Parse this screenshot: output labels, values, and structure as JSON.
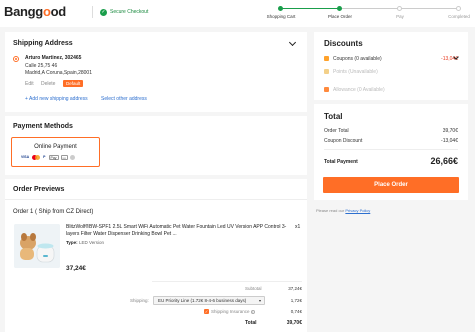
{
  "header": {
    "logo_left": "Bangg",
    "logo_o": "o",
    "logo_right": "od",
    "secure_label": "Secure Checkout",
    "secure_icon": "check-shield-icon",
    "steps": [
      "Shopping Cart",
      "Place Order",
      "Pay",
      "Completed"
    ],
    "active_step": 2
  },
  "shipping": {
    "title": "Shipping Address",
    "name": "Arturo Martinez, 302465",
    "line1": "Calle 25,75 46",
    "line2": "Madrid,A Coruna,Spain,28001",
    "edit": "Edit",
    "delete": "Delete",
    "default_badge": "Default",
    "add_link": "+ Add new shipping address",
    "select_link": "Select other address"
  },
  "payment": {
    "title": "Payment Methods",
    "option_label": "Online Payment",
    "logos": [
      "VISA",
      "PayPal",
      "Apple Pay",
      "Card"
    ]
  },
  "order": {
    "title": "Order Previews",
    "ship_from": "Order 1 ( Ship from CZ Direct)",
    "product_title": "BlitzWolf®BW-SPF1 2.5L Smart WiFi Automatic Pet Water Fountain Led UV Version APP Control 3-layers Filter Water Dispenser Drinking Bowl Pet ...",
    "type_label": "Type:",
    "type_value": "LED Version",
    "qty": "x1",
    "price": "37,24€",
    "subtotal_label": "Subtotal",
    "subtotal_value": "37,24€",
    "shipping_label": "Shipping:",
    "shipping_option": "EU Priority Line (1.72€ 8-4-6 business days)",
    "shipping_value": "1,72€",
    "insurance_label": "Shipping Insurance",
    "insurance_value": "0,74€",
    "total_label": "Total",
    "total_value": "39,70€"
  },
  "discounts": {
    "title": "Discounts",
    "coupons_label": "Coupons (0 available)",
    "coupons_value": "-13,04€",
    "points_label": "Points (Unavailable)",
    "allowance_label": "Allowance (0 Available)"
  },
  "total": {
    "title": "Total",
    "order_total_label": "Order Total",
    "order_total_value": "39,70€",
    "coupon_discount_label": "Coupon Discount",
    "coupon_discount_value": "-13,04€",
    "total_payment_label": "Total Payment",
    "total_payment_value": "26,66€",
    "place_order": "Place Order",
    "privacy_prefix": "Please read our",
    "privacy_link": "Privacy Policy"
  },
  "colors": {
    "accent": "#ff6e26",
    "step_active": "#1a9e4b",
    "link": "#2d6fcf"
  }
}
